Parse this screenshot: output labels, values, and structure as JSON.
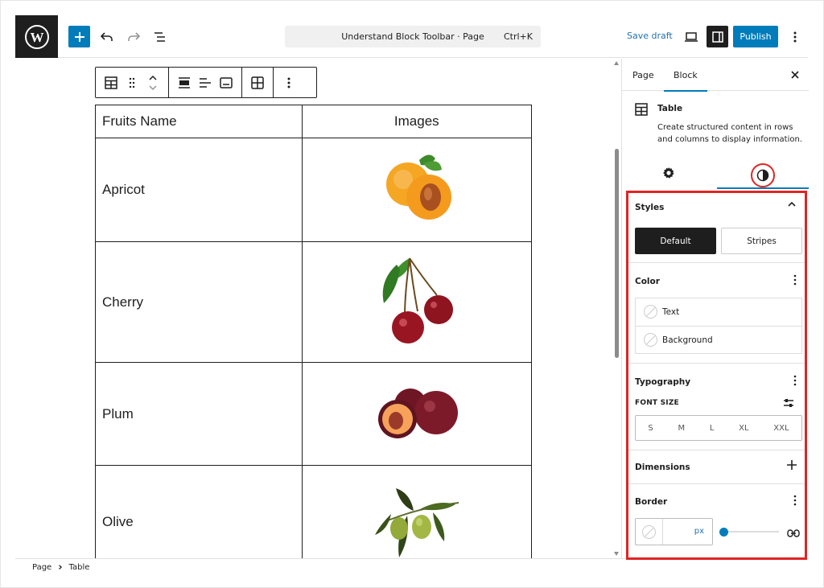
{
  "topbar": {
    "doc_title": "Understand Block Toolbar · Page",
    "shortcut": "Ctrl+K",
    "save_draft": "Save draft",
    "publish": "Publish"
  },
  "table": {
    "headers": [
      "Fruits Name",
      "Images"
    ],
    "rows": [
      {
        "name": "Apricot",
        "image": "apricot"
      },
      {
        "name": "Cherry",
        "image": "cherry"
      },
      {
        "name": "Plum",
        "image": "plum"
      },
      {
        "name": "Olive",
        "image": "olive"
      }
    ]
  },
  "footer": {
    "breadcrumb": [
      "Page",
      "Table"
    ],
    "separator": "›"
  },
  "sidebar": {
    "tabs": [
      "Page",
      "Block"
    ],
    "active_tab": "Block",
    "block": {
      "title": "Table",
      "description": "Create structured content in rows and columns to display information."
    },
    "styles": {
      "heading": "Styles",
      "options": [
        "Default",
        "Stripes"
      ],
      "selected": "Default"
    },
    "color": {
      "heading": "Color",
      "items": [
        "Text",
        "Background"
      ]
    },
    "typography": {
      "heading": "Typography",
      "font_size_label": "FONT SIZE",
      "sizes": [
        "S",
        "M",
        "L",
        "XL",
        "XXL"
      ]
    },
    "dimensions": {
      "heading": "Dimensions"
    },
    "border": {
      "heading": "Border",
      "unit": "px"
    }
  },
  "colors": {
    "accent": "#007cba",
    "highlight": "#e02424",
    "dark": "#1e1e1e"
  }
}
